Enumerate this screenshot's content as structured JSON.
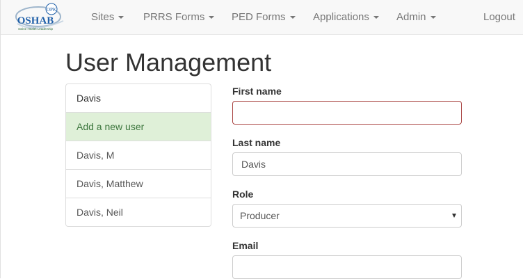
{
  "logo": {
    "text": "OSHAB",
    "badge": "OPK",
    "tagline": "Swine Health Leadership"
  },
  "nav": {
    "items": [
      {
        "label": "Sites"
      },
      {
        "label": "PRRS Forms"
      },
      {
        "label": "PED Forms"
      },
      {
        "label": "Applications"
      },
      {
        "label": "Admin"
      }
    ],
    "logout": "Logout"
  },
  "page": {
    "title": "User Management"
  },
  "user_list": {
    "items": [
      {
        "label": "Davis",
        "active": false
      },
      {
        "label": "Add a new user",
        "active": true
      },
      {
        "label": "Davis, M",
        "active": false
      },
      {
        "label": "Davis, Matthew",
        "active": false
      },
      {
        "label": "Davis, Neil",
        "active": false
      }
    ]
  },
  "form": {
    "first_name": {
      "label": "First name",
      "value": ""
    },
    "last_name": {
      "label": "Last name",
      "value": "Davis"
    },
    "role": {
      "label": "Role",
      "value": "Producer"
    },
    "email": {
      "label": "Email",
      "value": ""
    }
  },
  "colors": {
    "navbar_bg": "#f8f8f8",
    "active_item_bg": "#dff0d8",
    "active_item_text": "#3c763d",
    "error_border": "#a94442",
    "logo_blue": "#1f5fa8"
  }
}
